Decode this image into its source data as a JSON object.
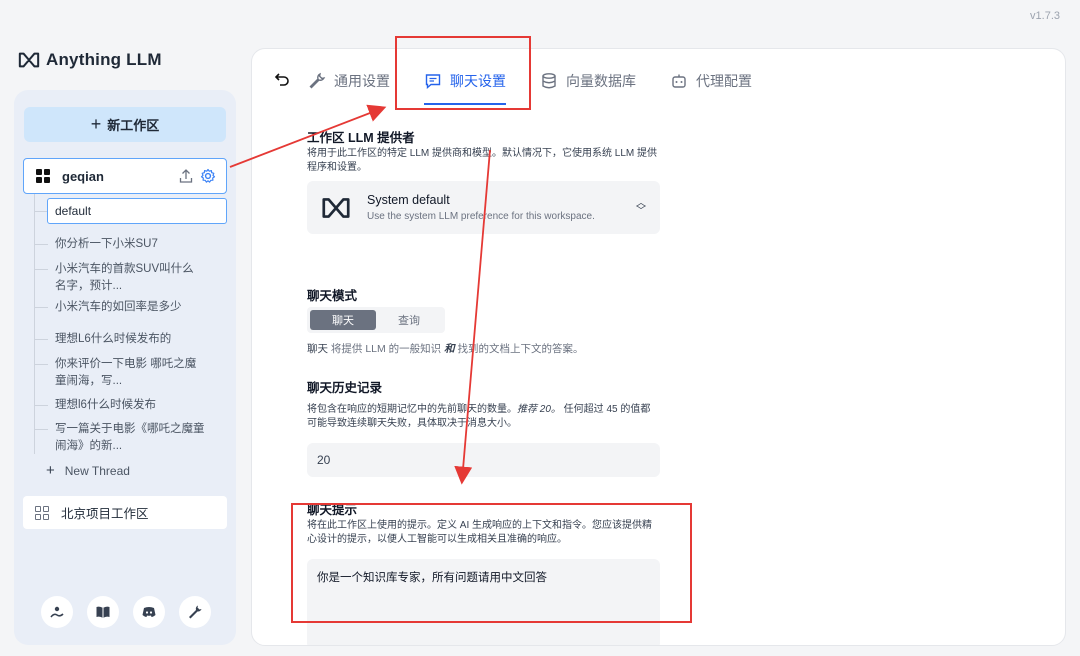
{
  "app": {
    "version": "v1.7.3",
    "brand": "Anything LLM"
  },
  "sidebar": {
    "new_workspace_label": "新工作区",
    "active_workspace": {
      "name": "geqian"
    },
    "threads": [
      {
        "label": "default",
        "selected": true
      },
      {
        "label": "你分析一下小米SU7"
      },
      {
        "label": "小米汽车的首款SUV叫什么名字，预计..."
      },
      {
        "label": "小米汽车的如回率是多少"
      },
      {
        "label": "理想L6什么时候发布的"
      },
      {
        "label": "你来评价一下电影 哪吒之魔童闹海，写..."
      },
      {
        "label": "理想l6什么时候发布"
      },
      {
        "label": "写一篇关于电影《哪吒之魔童闹海》的新..."
      }
    ],
    "new_thread_label": "New Thread",
    "other_workspace": {
      "name": "北京项目工作区"
    },
    "footer_icons": [
      "community-hub-icon",
      "docs-book-icon",
      "discord-icon",
      "settings-wrench-icon"
    ]
  },
  "tabs": [
    {
      "label": "通用设置",
      "icon": "wrench-icon"
    },
    {
      "label": "聊天设置",
      "icon": "chat-icon",
      "active": true
    },
    {
      "label": "向量数据库",
      "icon": "database-icon"
    },
    {
      "label": "代理配置",
      "icon": "robot-icon"
    }
  ],
  "llm_provider": {
    "title": "工作区 LLM 提供者",
    "description": "将用于此工作区的特定 LLM 提供商和模型。默认情况下，它使用系统 LLM 提供程序和设置。",
    "selected_name": "System default",
    "selected_sub": "Use the system LLM preference for this workspace."
  },
  "chat_mode": {
    "title": "聊天模式",
    "options": [
      "聊天",
      "查询"
    ],
    "selected": "聊天",
    "desc_prefix": "聊天",
    "desc_mid": " 将提供 LLM 的一般知识 ",
    "desc_and": "和",
    "desc_suffix": " 找到的文档上下文的答案。"
  },
  "chat_history": {
    "title": "聊天历史记录",
    "description_1": "将包含在响应的短期记忆中的先前聊天的数量。",
    "recommend": "推荐 20。",
    "description_2": " 任何超过 45 的值都可能导致连续聊天失败，具体取决于消息大小。",
    "value": "20"
  },
  "chat_prompt": {
    "title": "聊天提示",
    "description": "将在此工作区上使用的提示。定义 AI 生成响应的上下文和指令。您应该提供精心设计的提示，以便人工智能可以生成相关且准确的响应。",
    "value": "你是一个知识库专家，所有问题请用中文回答"
  },
  "colors": {
    "accent": "#2563eb",
    "annotation_red": "#e53935",
    "sidebar_bg": "#e9eef7",
    "new_ws_btn_bg": "#cfe6fb"
  }
}
